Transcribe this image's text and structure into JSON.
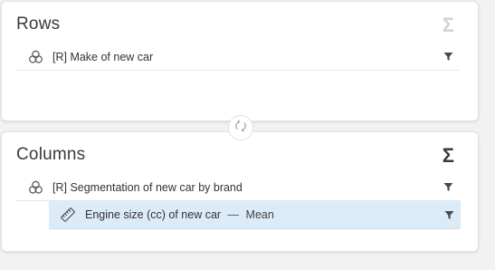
{
  "rows": {
    "title": "Rows",
    "sigma": "Σ",
    "items": [
      {
        "label": "[R] Make of new car",
        "icon": "venn-icon"
      }
    ]
  },
  "columns": {
    "title": "Columns",
    "sigma": "Σ",
    "items": [
      {
        "label": "[R] Segmentation of new car by brand",
        "icon": "venn-icon"
      }
    ],
    "measure": {
      "label": "Engine size (cc) of new car",
      "separator": "—",
      "aggregation": "Mean",
      "icon": "ruler-icon"
    }
  },
  "swap": {
    "icon": "swap-icon"
  },
  "colors": {
    "selected_bg": "#dcebf8",
    "sigma_disabled": "#d2d2d2",
    "sigma_enabled": "#3a3a3a"
  }
}
